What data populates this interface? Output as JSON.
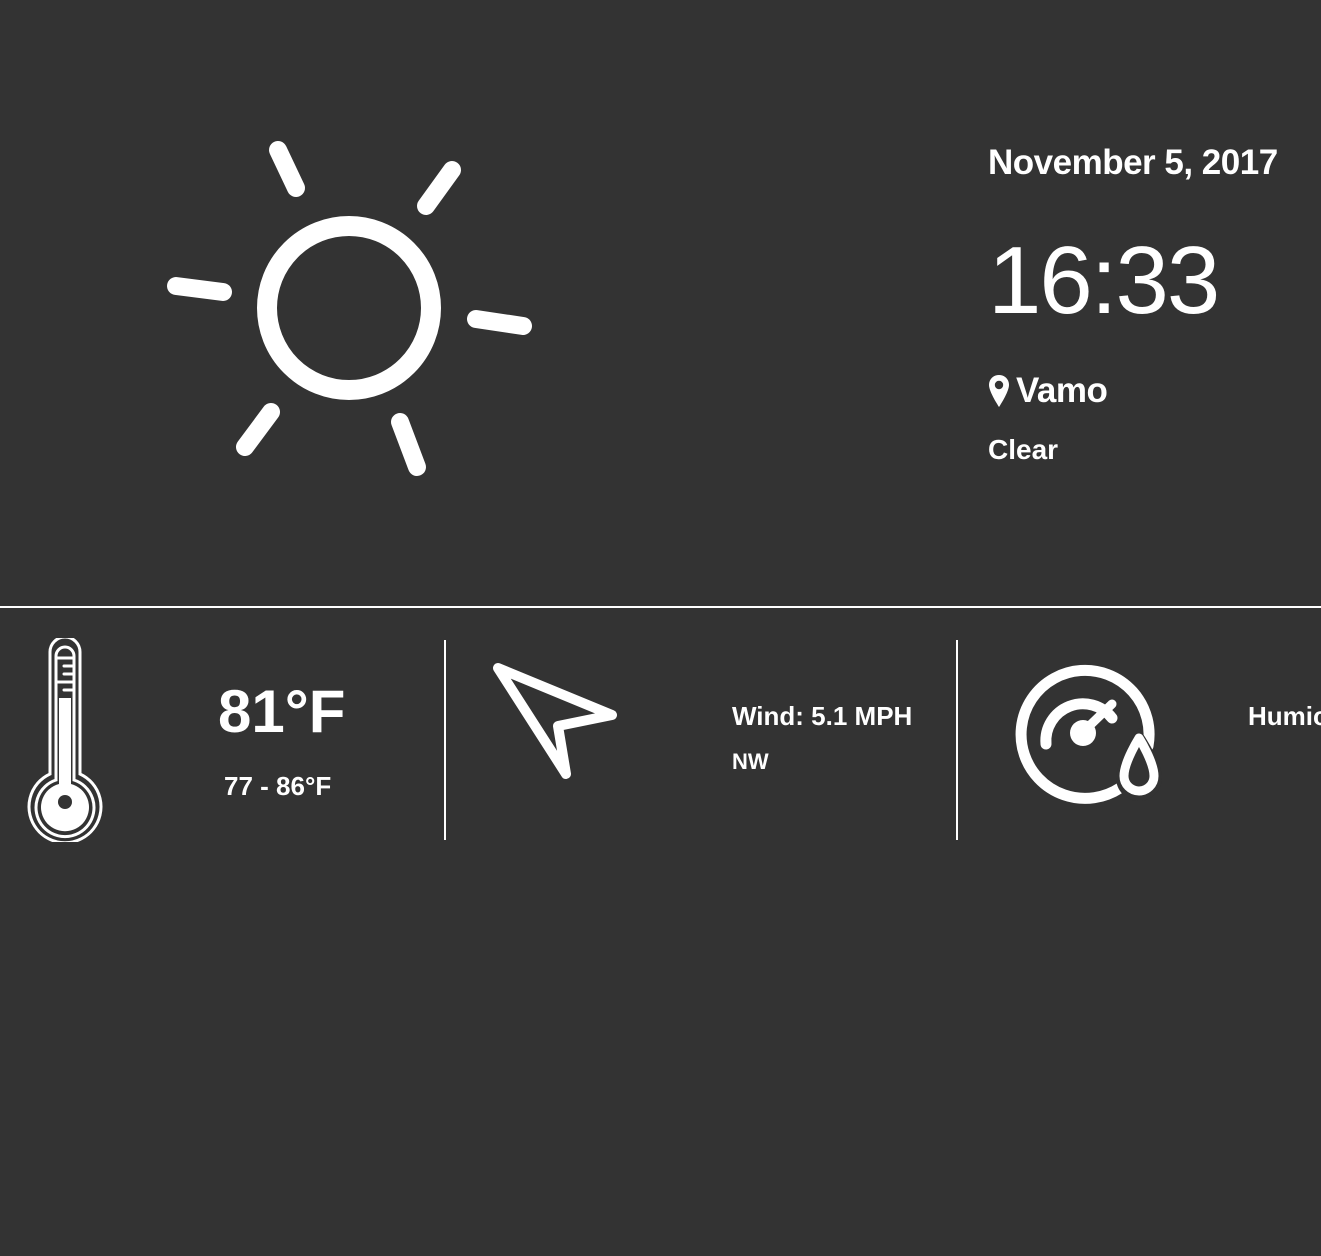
{
  "header": {
    "condition_icon": "sun-icon",
    "date": "November 5, 2017",
    "time": "16:33",
    "location_icon": "map-pin-icon",
    "location": "Vamo",
    "condition": "Clear"
  },
  "stats": {
    "temperature": {
      "icon": "thermometer-icon",
      "current": "81°F",
      "range": "77 - 86°F"
    },
    "wind": {
      "icon": "wind-direction-arrow-icon",
      "speed": "Wind: 5.1 MPH",
      "direction": "NW"
    },
    "humidity": {
      "icon": "humidity-gauge-icon",
      "label": "Humic"
    }
  },
  "colors": {
    "background": "#333333",
    "foreground": "#ffffff"
  }
}
